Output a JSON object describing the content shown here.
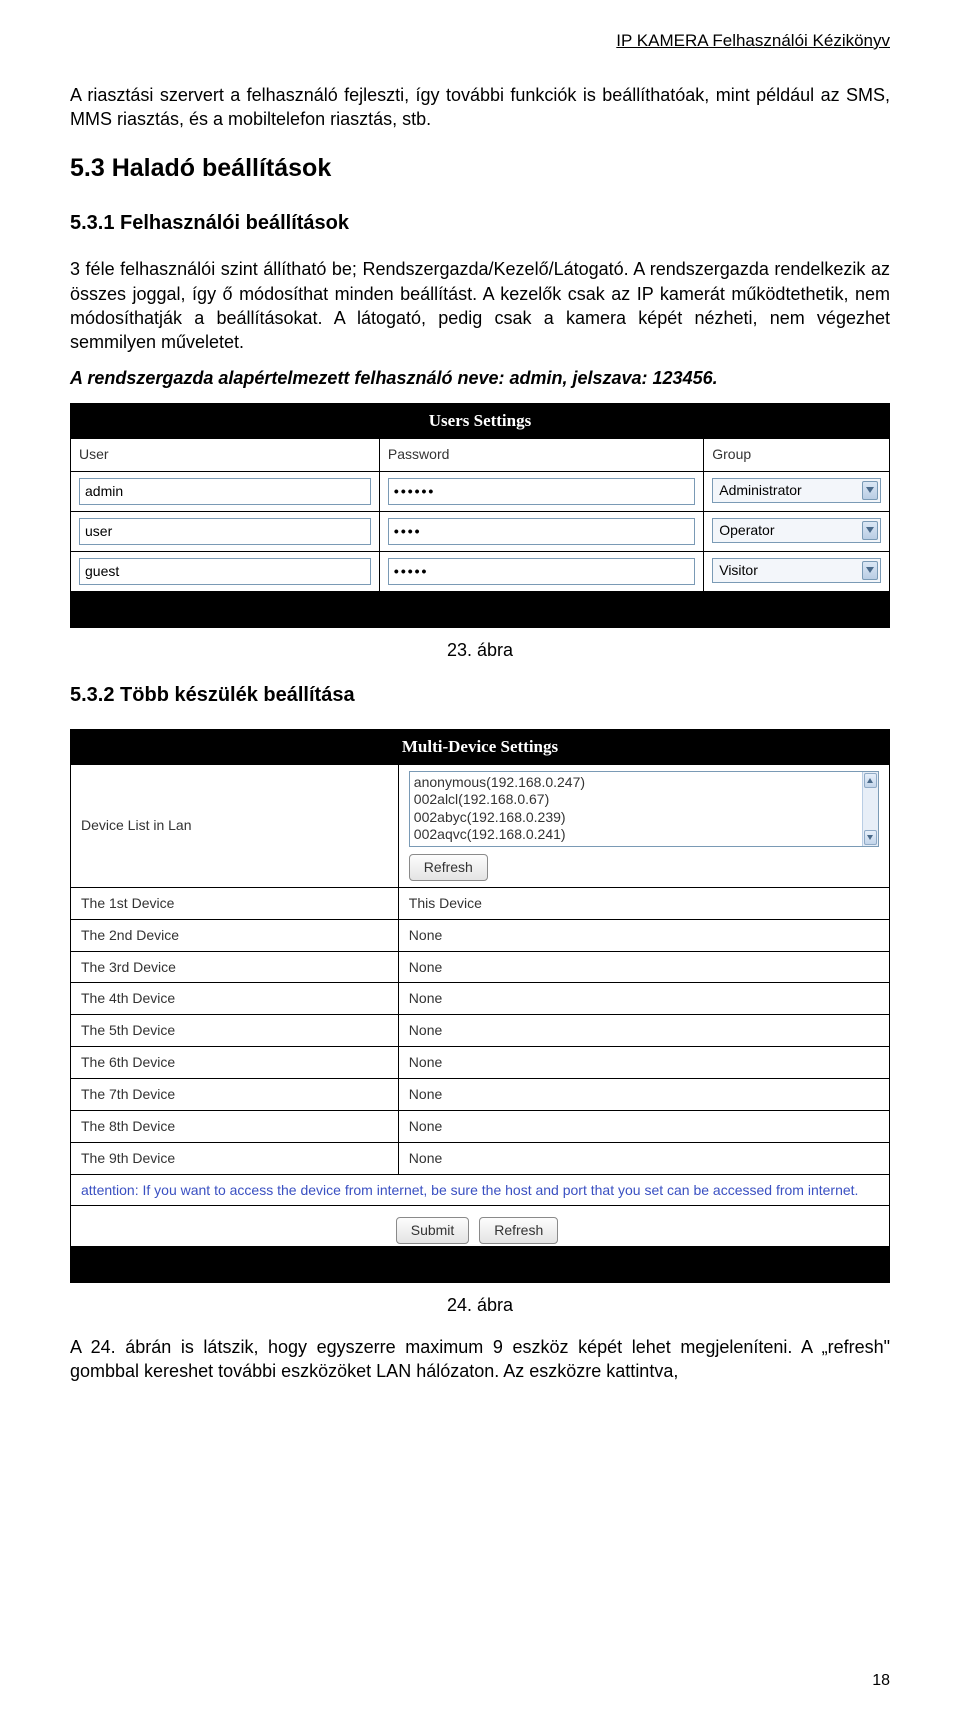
{
  "header": "IP KAMERA Felhasználói Kézikönyv",
  "intro": "A riasztási szervert a felhasználó fejleszti, így további funkciók is beállíthatóak, mint például az SMS, MMS riasztás, és a mobiltelefon riasztás, stb.",
  "h53": "5.3 Haladó beállítások",
  "h531": "5.3.1 Felhasználói beállítások",
  "p531a": "3 féle felhasználói szint állítható be; Rendszergazda/Kezelő/Látogató. A rendszergazda rendelkezik az összes joggal, így ő módosíthat minden beállítást. A kezelők csak az IP kamerát működtethetik, nem módosíthatják a beállításokat. A látogató, pedig csak a kamera képét nézheti, nem végezhet semmilyen műveletet.",
  "p531b": "A rendszergazda alapértelmezett felhasználó neve: admin, jelszava: 123456.",
  "fig23": "23. ábra",
  "users": {
    "title": "Users Settings",
    "cols": {
      "user": "User",
      "password": "Password",
      "group": "Group"
    },
    "rows": [
      {
        "user": "admin",
        "pass": "••••••",
        "group": "Administrator"
      },
      {
        "user": "user",
        "pass": "••••",
        "group": "Operator"
      },
      {
        "user": "guest",
        "pass": "•••••",
        "group": "Visitor"
      }
    ]
  },
  "h532": "5.3.2 Több készülék beállítása",
  "multi": {
    "title": "Multi-Device Settings",
    "devlabel": "Device List in Lan",
    "list": [
      "anonymous(192.168.0.247)",
      "002alcl(192.168.0.67)",
      "002abyc(192.168.0.239)",
      "002aqvc(192.168.0.241)"
    ],
    "refresh": "Refresh",
    "rows": [
      {
        "label": "The 1st Device",
        "value": "This Device"
      },
      {
        "label": "The 2nd Device",
        "value": "None"
      },
      {
        "label": "The 3rd Device",
        "value": "None"
      },
      {
        "label": "The 4th Device",
        "value": "None"
      },
      {
        "label": "The 5th Device",
        "value": "None"
      },
      {
        "label": "The 6th Device",
        "value": "None"
      },
      {
        "label": "The 7th Device",
        "value": "None"
      },
      {
        "label": "The 8th Device",
        "value": "None"
      },
      {
        "label": "The 9th Device",
        "value": "None"
      }
    ],
    "attention": "attention: If you want to access the device from internet, be sure the host and port that you set can be accessed from internet.",
    "submit": "Submit",
    "refresh2": "Refresh"
  },
  "fig24": "24. ábra",
  "outro": "A 24. ábrán is látszik, hogy egyszerre maximum 9 eszköz képét lehet megjeleníteni. A „refresh\" gombbal kereshet további eszközöket LAN hálózaton. Az eszközre kattintva,",
  "pagenum": "18"
}
